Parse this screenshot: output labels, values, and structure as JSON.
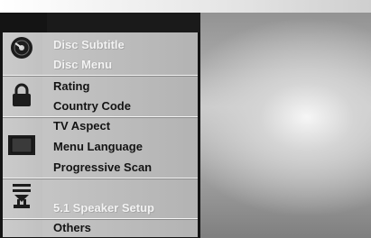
{
  "menu": {
    "categories": [
      {
        "icon": "disc-icon",
        "items": [
          "Disc Subtitle",
          "Disc Menu"
        ]
      },
      {
        "icon": "padlock-icon",
        "items": [
          "Rating",
          "Country Code"
        ]
      },
      {
        "icon": "tv-screen-icon",
        "items": [
          "TV Aspect",
          "Menu Language",
          "Progressive Scan"
        ]
      },
      {
        "icon": "speaker-setup-icon",
        "items": [
          "5.1 Speaker Setup"
        ]
      }
    ],
    "others_label": "Others"
  }
}
